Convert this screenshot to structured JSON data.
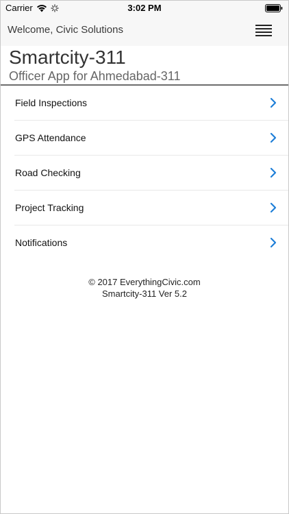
{
  "status_bar": {
    "carrier": "Carrier",
    "time": "3:02 PM",
    "icons": [
      "wifi-icon",
      "activity-icon",
      "battery-icon"
    ]
  },
  "nav_bar": {
    "welcome": "Welcome, Civic Solutions",
    "menu_icon": "hamburger-icon"
  },
  "header": {
    "title": "Smartcity-311",
    "subtitle": "Officer App for Ahmedabad-311"
  },
  "menu": {
    "items": [
      {
        "label": "Field Inspections"
      },
      {
        "label": "GPS Attendance"
      },
      {
        "label": "Road Checking"
      },
      {
        "label": "Project Tracking"
      },
      {
        "label": "Notifications"
      }
    ],
    "chevron_color": "#1e7fd8"
  },
  "footer": {
    "copyright": "© 2017 EverythingCivic.com",
    "version": "Smartcity-311 Ver 5.2"
  }
}
